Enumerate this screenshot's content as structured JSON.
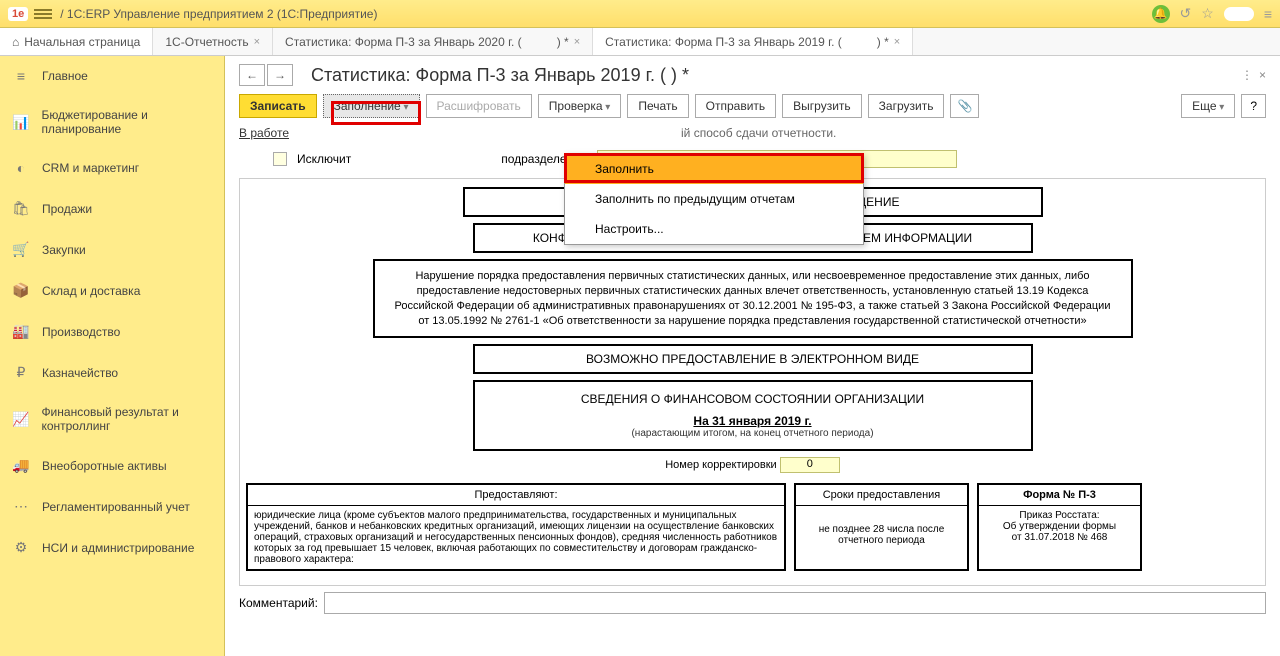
{
  "titlebar": {
    "text": "/ 1C:ERP Управление предприятием 2  (1С:Предприятие)"
  },
  "tabs": {
    "home": "Начальная страница",
    "items": [
      {
        "label": "1С-Отчетность",
        "close": true
      },
      {
        "label": "Статистика: Форма П-3 за Январь 2020 г. (",
        "suffix": ") *",
        "close": true,
        "active": false
      },
      {
        "label": "Статистика: Форма П-3 за Январь 2019 г. (",
        "suffix": ") *",
        "close": true,
        "active": true
      }
    ]
  },
  "sidebar": {
    "items": [
      {
        "icon": "≡",
        "label": "Главное"
      },
      {
        "icon": "📊",
        "label": "Бюджетирование и планирование"
      },
      {
        "icon": "◐",
        "label": "CRM и маркетинг"
      },
      {
        "icon": "🛍",
        "label": "Продажи"
      },
      {
        "icon": "🛒",
        "label": "Закупки"
      },
      {
        "icon": "📦",
        "label": "Склад и доставка"
      },
      {
        "icon": "🏭",
        "label": "Производство"
      },
      {
        "icon": "₽",
        "label": "Казначейство"
      },
      {
        "icon": "📈",
        "label": "Финансовый результат и контроллинг"
      },
      {
        "icon": "🚚",
        "label": "Внеоборотные активы"
      },
      {
        "icon": "⋯",
        "label": "Регламентированный учет"
      },
      {
        "icon": "⚙",
        "label": "НСИ и администрирование"
      }
    ]
  },
  "page": {
    "title": "Статистика: Форма П-3 за Январь 2019 г. (                    ) *"
  },
  "toolbar": {
    "write": "Записать",
    "fill": "Заполнение",
    "decode": "Расшифровать",
    "check": "Проверка",
    "print": "Печать",
    "send": "Отправить",
    "export": "Выгрузить",
    "import": "Загрузить",
    "more": "Еще",
    "help": "?"
  },
  "menu": {
    "i1": "Заполнить",
    "i2": "Заполнить по предыдущим отчетам",
    "i3": "Настроить..."
  },
  "status": {
    "link": "В работе",
    "text": "ій способ сдачи отчетности."
  },
  "form": {
    "exclude_partial": "Исключит",
    "obosob_label": "подразделение",
    "obosob_value": ""
  },
  "report": {
    "b1": "ФЕДЕРАЛЬНОЕ СТАТИСТИЧЕСКОЕ НАБЛЮДЕНИЕ",
    "b2": "КОНФИДЕНЦИАЛЬНОСТЬ ГАРАНТИРУЕТСЯ ПОЛУЧАТЕЛЕМ ИНФОРМАЦИИ",
    "b3": "Нарушение порядка предоставления первичных статистических данных, или несвоевременное предоставление этих данных, либо  предоставление недостоверных первичных статистических данных влечет ответственность, установленную статьей 13.19 Кодекса Российской Федерации об административных правонарушениях от 30.12.2001 № 195-ФЗ, а также статьей 3 Закона Российской Федерации от 13.05.1992 № 2761-1 «Об ответственности за нарушение порядка представления государственной статистической отчетности»",
    "b4": "ВОЗМОЖНО ПРЕДОСТАВЛЕНИЕ В ЭЛЕКТРОННОМ ВИДЕ",
    "b5_title": "СВЕДЕНИЯ О ФИНАНСОВОМ СОСТОЯНИИ ОРГАНИЗАЦИИ",
    "b5_date": "На 31 января 2019 г.",
    "b5_note": "(нарастающим итогом, на конец отчетного периода)",
    "corr_label": "Номер корректировки",
    "corr_value": "0",
    "tbl": {
      "c1_head": "Предоставляют:",
      "c1_body": "юридические лица (кроме субъектов малого предпринимательства, государственных и муниципальных учреждений, банков и небанковских кредитных организаций, имеющих лицензии на осуществление банковских операций, страховых организаций и негосударственных пенсионных фондов), средняя численность работников которых за год превышает 15 человек, включая работающих по совместительству и договорам гражданско-правового характера:",
      "c2_head": "Сроки предоставления",
      "c2_body": "не позднее 28 числа после отчетного периода",
      "c3_head": "Форма № П-3",
      "c3_l1": "Приказ Росстата:",
      "c3_l2": "Об утверждении формы",
      "c3_l3": "от 31.07.2018 № 468"
    }
  },
  "comment": {
    "label": "Комментарий:"
  }
}
